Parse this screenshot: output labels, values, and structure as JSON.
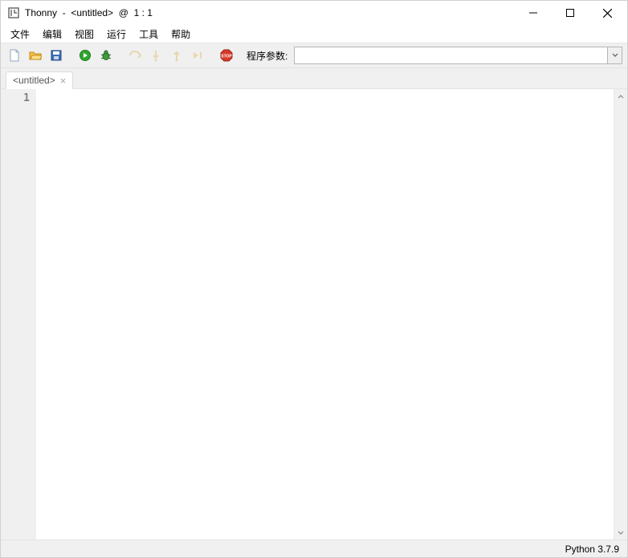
{
  "window": {
    "title": "Thonny  -  <untitled>  @  1 : 1"
  },
  "menu": {
    "items": [
      "文件",
      "编辑",
      "视图",
      "运行",
      "工具",
      "帮助"
    ]
  },
  "toolbar": {
    "param_label": "程序参数:",
    "param_value": ""
  },
  "tabs": {
    "items": [
      {
        "label": "<untitled>"
      }
    ]
  },
  "editor": {
    "line_numbers": [
      "1"
    ]
  },
  "status": {
    "interpreter": "Python 3.7.9"
  }
}
